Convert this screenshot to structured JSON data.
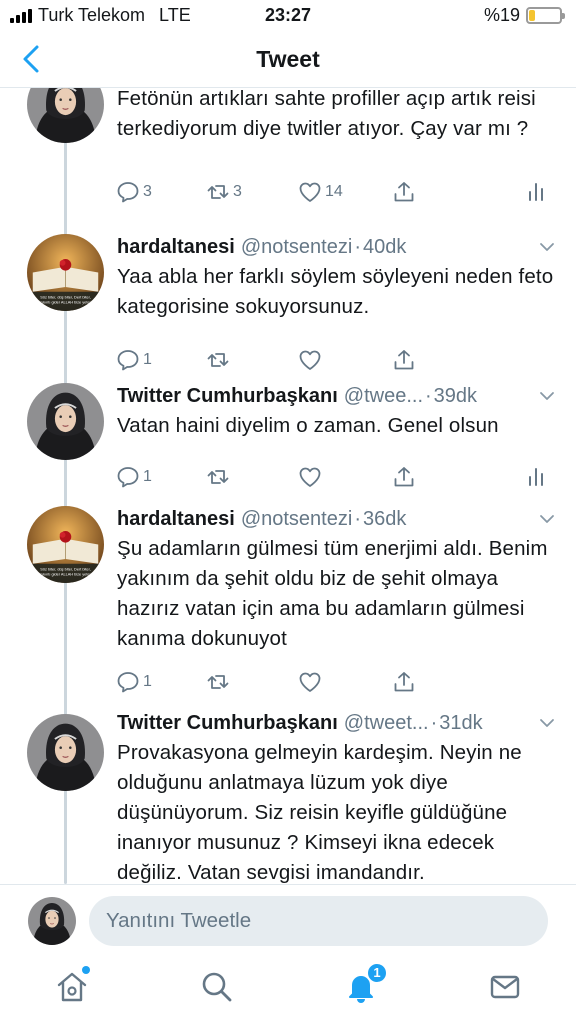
{
  "status_bar": {
    "carrier": "Turk Telekom",
    "network": "LTE",
    "time": "23:27",
    "battery_text": "%19",
    "battery_level": 0.19
  },
  "nav": {
    "title": "Tweet",
    "back_icon": "chevron-left-icon"
  },
  "tweets": [
    {
      "avatar": "hijab-profile",
      "text": "Fetönün artıkları sahte profiller açıp artık reisi terkediyorum diye twitler atıyor. Çay var mı ?",
      "reply_count": "3",
      "retweet_count": "3",
      "like_count": "14",
      "show_stats": true
    },
    {
      "avatar": "book-rose",
      "avatar_caption": "Söz biter, düş biter, Dert biter, sıkıntı gider ALLAH bize yeter",
      "name": "hardaltanesi",
      "handle": "@notsentezi",
      "time": "40dk",
      "text": "Yaa abla her farklı söylem söyleyeni neden feto kategorisine sokuyorsunuz.",
      "reply_count": "1",
      "retweet_count": "",
      "like_count": "",
      "show_stats": false
    },
    {
      "avatar": "hijab-profile",
      "name": "Twitter Cumhurbaşkanı",
      "handle": "@twee...",
      "time": "39dk",
      "text": "Vatan haini diyelim o zaman. Genel olsun",
      "reply_count": "1",
      "retweet_count": "",
      "like_count": "",
      "show_stats": true
    },
    {
      "avatar": "book-rose",
      "avatar_caption": "Söz biter, düş biter, Dert biter, sıkıntı gider ALLAH bize yeter",
      "name": "hardaltanesi",
      "handle": "@notsentezi",
      "time": "36dk",
      "text": "Şu adamların gülmesi tüm enerjimi aldı. Benim yakınım da şehit oldu biz de şehit olmaya hazırız vatan için ama bu adamların gülmesi kanıma dokunuyot",
      "reply_count": "1",
      "retweet_count": "",
      "like_count": "",
      "show_stats": false
    },
    {
      "avatar": "hijab-profile",
      "name": "Twitter Cumhurbaşkanı",
      "handle": "@tweet...",
      "time": "31dk",
      "text": "Provakasyona gelmeyin kardeşim. Neyin ne olduğunu anlatmaya lüzum yok diye düşünüyorum. Siz reisin keyifle güldüğüne inanıyor musunuz ? Kimseyi ikna edecek değiliz. Vatan sevgisi imandandır.",
      "reply_count": "",
      "retweet_count": "",
      "like_count": "",
      "show_stats": false
    }
  ],
  "reply_bar": {
    "placeholder": "Yanıtını Tweetle"
  },
  "tab_bar": {
    "items": [
      "home-icon",
      "search-icon",
      "notifications-icon",
      "messages-icon"
    ],
    "notification_badge": "1"
  },
  "colors": {
    "accent": "#1da1f2",
    "secondary_text": "#657786",
    "divider": "#e1e8ed"
  }
}
